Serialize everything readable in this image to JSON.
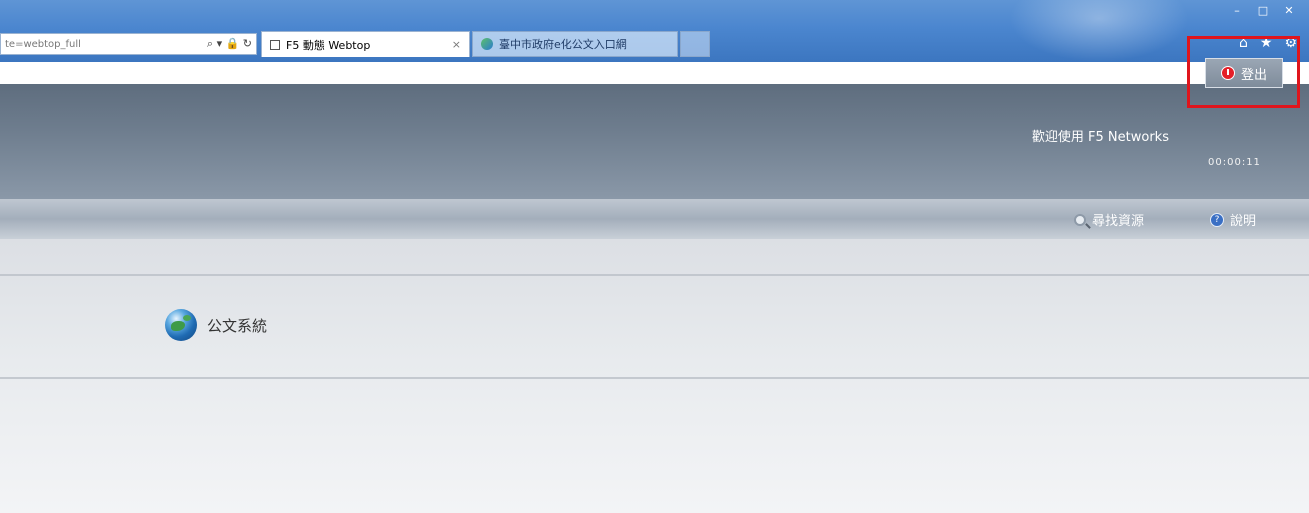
{
  "browser": {
    "address_url": "te=webtop_full",
    "address_tools": "⌕ ▾ 🔒 ↻",
    "tabs": [
      {
        "label": "F5 動態 Webtop",
        "close": "×"
      },
      {
        "label": "臺中市政府e化公文入口網"
      }
    ],
    "window_controls": [
      "–",
      "□",
      "✕"
    ],
    "toolbar_icons": [
      "home-icon",
      "star-icon",
      "gear-icon"
    ],
    "toolbar_glyphs": [
      "⌂",
      "★",
      "⚙"
    ]
  },
  "header": {
    "welcome_text": "歡迎使用 F5 Networks",
    "logout_label": "登出",
    "session_timer": "00:00:11"
  },
  "toolbar": {
    "find_label": "尋找資源",
    "help_label": "說明"
  },
  "resources": [
    {
      "label": "公文系統",
      "icon": "globe-icon"
    }
  ],
  "colors": {
    "header_bg": "#6e7d8e",
    "highlight_frame": "#e0151c",
    "logout_icon": "#e41f28"
  }
}
